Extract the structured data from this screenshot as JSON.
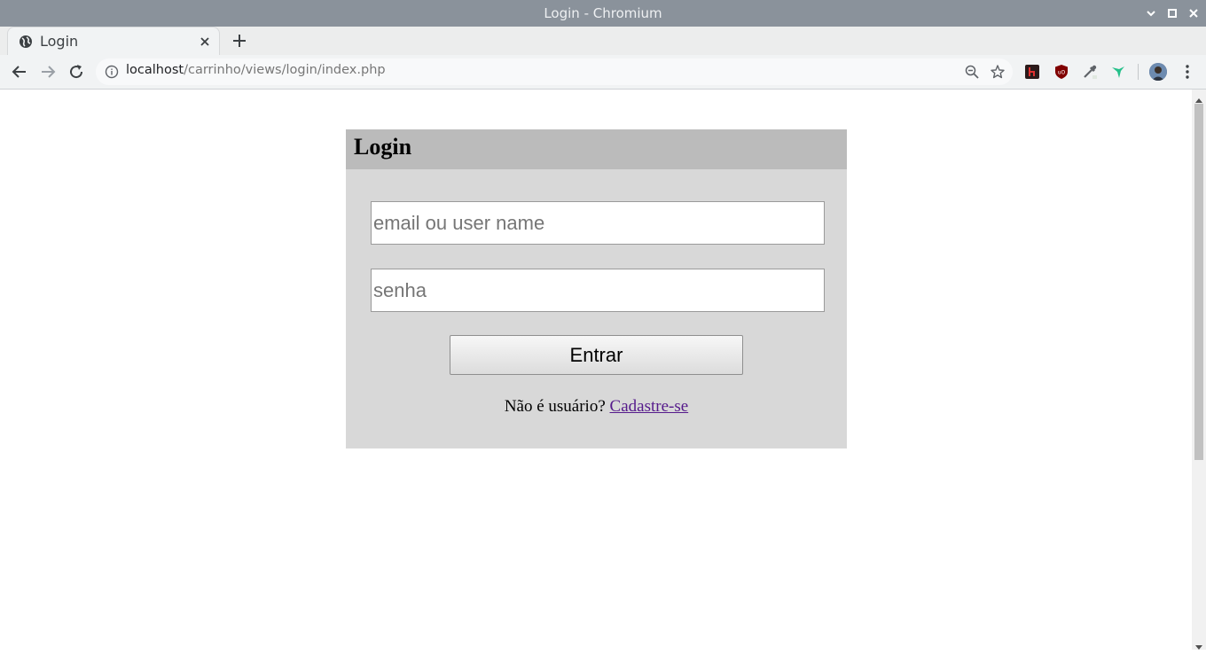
{
  "window": {
    "title": "Login - Chromium"
  },
  "tab": {
    "title": "Login",
    "icon": "globe-icon"
  },
  "address_bar": {
    "host": "localhost",
    "path": "/carrinho/views/login/index.php"
  },
  "colors": {
    "titlebar": "#8a929b",
    "login_header": "#bbbbbb",
    "login_body": "#d8d8d8",
    "link_visited": "#551a8b"
  },
  "login": {
    "heading": "Login",
    "email_placeholder": "email ou user name",
    "password_placeholder": "senha",
    "submit_label": "Entrar",
    "signup_prompt": "Não é usuário?",
    "signup_link": "Cadastre-se"
  }
}
